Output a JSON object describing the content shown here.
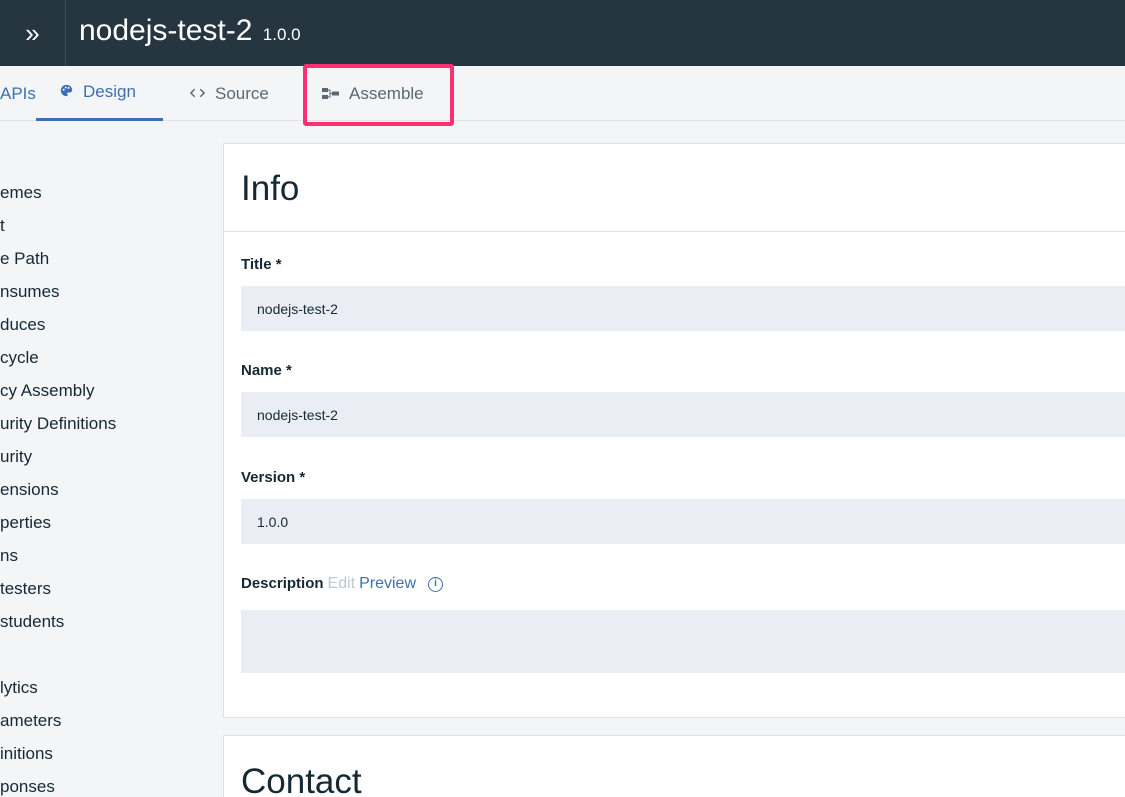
{
  "header": {
    "title": "nodejs-test-2",
    "version": "1.0.0",
    "expand_icon": "»"
  },
  "tabs": {
    "apis": "APIs",
    "design": "Design",
    "source": "Source",
    "assemble": "Assemble",
    "design_icon": "palette-icon",
    "source_icon": "code-icon",
    "assemble_icon": "assemble-icon"
  },
  "sidebar": {
    "items": [
      "emes",
      "t",
      "e Path",
      "nsumes",
      "duces",
      "cycle",
      "cy Assembly",
      "urity Definitions",
      "urity",
      "ensions",
      "perties",
      "ns",
      "testers",
      "students",
      "lytics",
      "ameters",
      "initions",
      "ponses"
    ]
  },
  "info": {
    "heading": "Info",
    "title_label": "Title *",
    "title_value": "nodejs-test-2",
    "name_label": "Name *",
    "name_value": "nodejs-test-2",
    "version_label": "Version *",
    "version_value": "1.0.0",
    "description_label": "Description",
    "description_edit": "Edit",
    "description_preview": "Preview",
    "description_value": ""
  },
  "contact": {
    "heading": "Contact"
  },
  "colors": {
    "topbar": "#263640",
    "accent": "#3d70b2",
    "highlight": "#ff3072",
    "input_bg": "#eaeef4"
  }
}
